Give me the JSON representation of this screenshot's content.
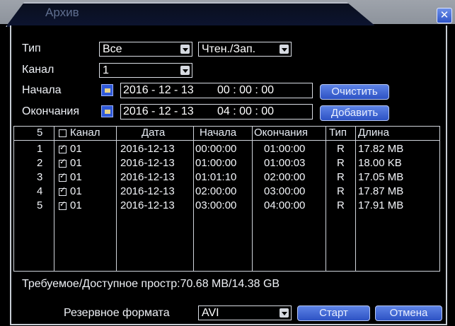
{
  "window": {
    "title": "Архив",
    "close_glyph": "✕"
  },
  "filters": {
    "type_label": "Тип",
    "type_value": "Все",
    "mode_value": "Чтен./Зап.",
    "channel_label": "Канал",
    "channel_value": "1",
    "start_label": "Начала",
    "start_date": "2016 - 12 - 13",
    "start_time": "00 : 00 : 00",
    "end_label": "Окончания",
    "end_date": "2016 - 12 - 13",
    "end_time": "04 : 00 : 00",
    "clear_button": "Очистить",
    "add_button": "Добавить"
  },
  "table": {
    "count": "5",
    "headers": {
      "channel": "Канал",
      "date": "Дата",
      "start": "Начала",
      "end": "Окончания",
      "type": "Тип",
      "length": "Длина"
    },
    "rows": [
      {
        "num": "1",
        "channel": "01",
        "date": "2016-12-13",
        "start": "00:00:00",
        "end": "01:00:00",
        "type": "R",
        "length": "17.82 MB"
      },
      {
        "num": "2",
        "channel": "01",
        "date": "2016-12-13",
        "start": "01:00:00",
        "end": "01:00:03",
        "type": "R",
        "length": "18.00 KB"
      },
      {
        "num": "3",
        "channel": "01",
        "date": "2016-12-13",
        "start": "01:01:10",
        "end": "02:00:00",
        "type": "R",
        "length": "17.05 MB"
      },
      {
        "num": "4",
        "channel": "01",
        "date": "2016-12-13",
        "start": "02:00:00",
        "end": "03:00:00",
        "type": "R",
        "length": "17.87 MB"
      },
      {
        "num": "5",
        "channel": "01",
        "date": "2016-12-13",
        "start": "03:00:00",
        "end": "04:00:00",
        "type": "R",
        "length": "17.91 MB"
      }
    ]
  },
  "space_info": "Требуемое/Доступное простр:70.68 MB/14.38 GB",
  "footer": {
    "format_label": "Резервное формата",
    "format_value": "AVI",
    "start_button": "Старт",
    "cancel_button": "Отмена"
  },
  "icons": {
    "calendar": "calendar-icon",
    "dropdown": "chevron-down-icon",
    "checkbox": "checkbox-icon"
  },
  "colors": {
    "background": "#000000",
    "button": "#3d63d6",
    "border": "#d0d4db"
  }
}
